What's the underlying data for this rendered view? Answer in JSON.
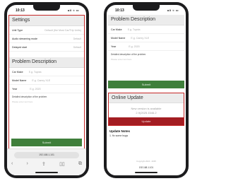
{
  "left": {
    "status_time": "10:13",
    "status_icons": "all ≈ ▭",
    "settings": {
      "title": "Settings",
      "rows": [
        {
          "label": "Unit Type",
          "value": "Default (the Most Car/Trip Units)"
        },
        {
          "label": "Audio streaming mode",
          "value": "Default"
        },
        {
          "label": "Delayed start",
          "value": "Default"
        }
      ]
    },
    "problem": {
      "title": "Problem Description",
      "rows": [
        {
          "label": "Car Make",
          "placeholder": "E.g. Toyota"
        },
        {
          "label": "Model Name",
          "placeholder": "E.g. Camry XLE"
        },
        {
          "label": "Year",
          "placeholder": "E.g. 2020"
        }
      ],
      "desc_label": "Detailed description of the problem",
      "desc_placeholder": "Please enter text here"
    },
    "submit_label": "Submit",
    "url": "192.168.1.101",
    "nav": {
      "back": "‹",
      "forward": "›",
      "share": "⇪",
      "bookmarks": "▯▯",
      "tabs": "⧉"
    }
  },
  "right": {
    "status_time": "10:13",
    "status_icons": "all ≈ ▭",
    "problem": {
      "title": "Problem Description",
      "rows": [
        {
          "label": "Car Make",
          "placeholder": "E.g. Toyota"
        },
        {
          "label": "Model Name",
          "placeholder": "E.g. Camry XLE"
        },
        {
          "label": "Year",
          "placeholder": "E.g. 2020"
        }
      ],
      "desc_label": "Detailed description of the problem",
      "desc_placeholder": "Please enter text here"
    },
    "submit_label": "Submit",
    "online_update": {
      "title": "Online Update",
      "message": "New version is available",
      "version": "2.9(2025.1546.2",
      "button": "Update"
    },
    "notes": {
      "title": "Update Notes",
      "item": "1. fix some bugs"
    },
    "footer_text": "Copyright 2024 - 2025",
    "url": "192.168.1.101"
  }
}
